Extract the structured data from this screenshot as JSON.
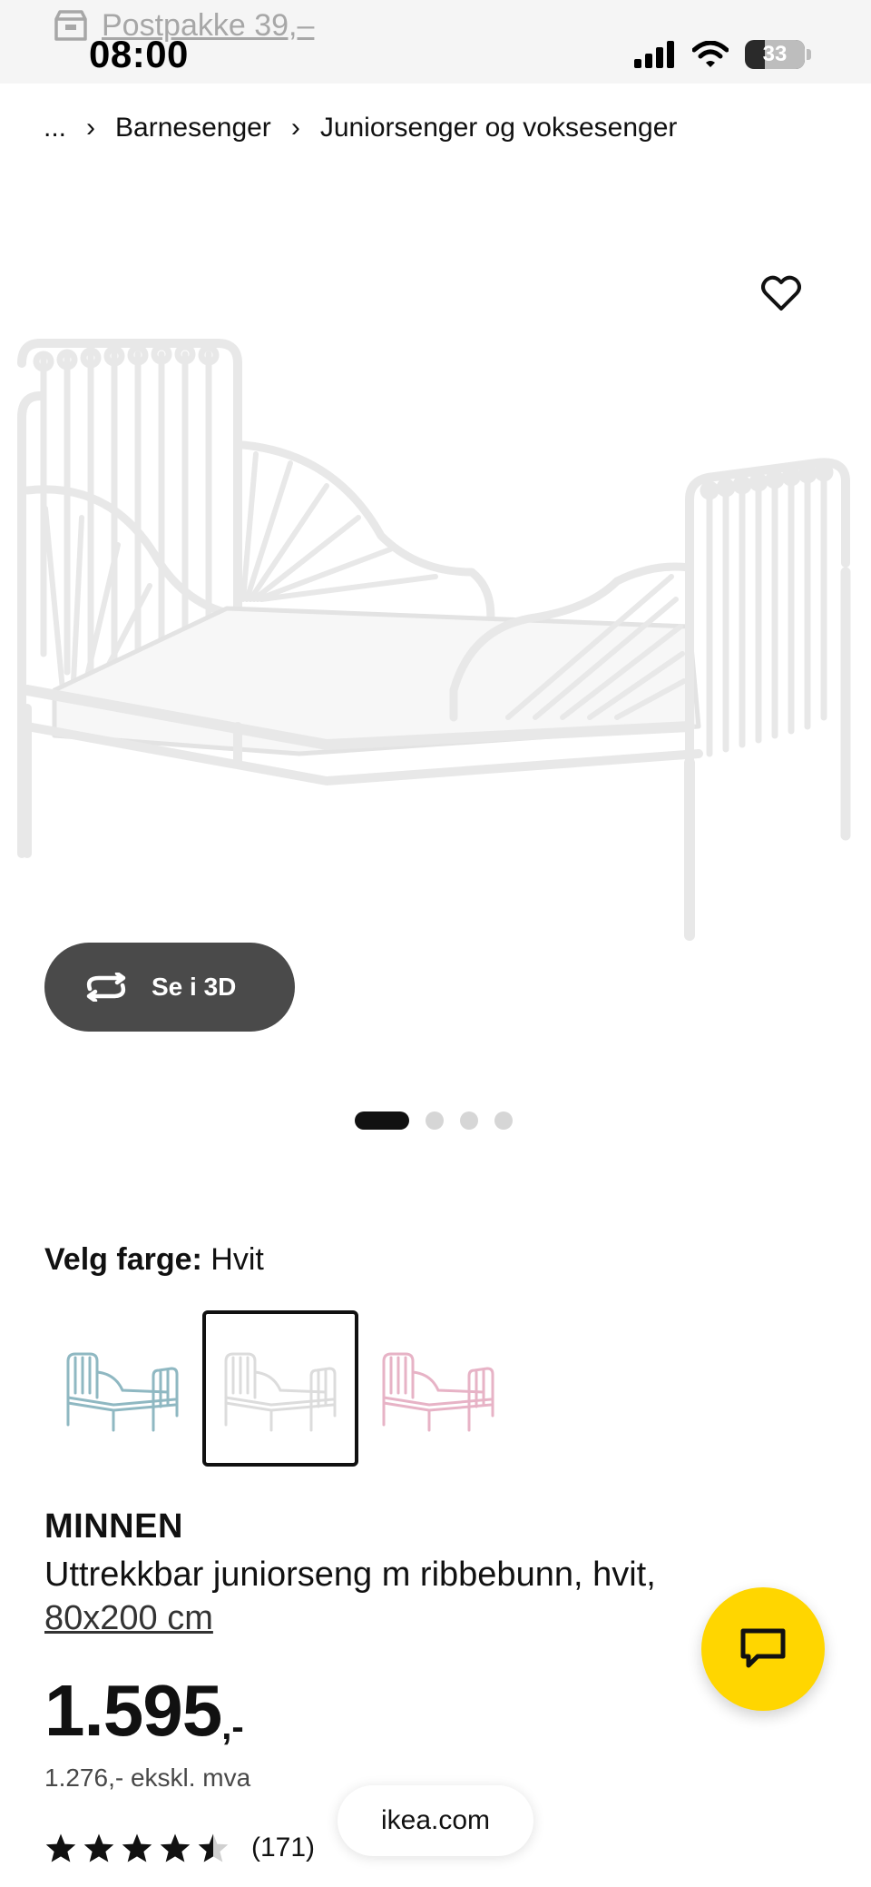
{
  "status_bar": {
    "time": "08:00",
    "notification_text": "Postpakke 39,–",
    "battery_level": "33",
    "icons": [
      "cellular-signal-icon",
      "wifi-icon",
      "battery-icon",
      "package-icon"
    ]
  },
  "breadcrumb": {
    "ellipsis": "...",
    "items": [
      "Barnesenger",
      "Juniorsenger og voksesenger"
    ],
    "separator_icon": "chevron-right-icon"
  },
  "gallery": {
    "view_3d_label": "Se i 3D",
    "view_3d_icon": "rotate-3d-icon",
    "favourite_icon": "heart-icon",
    "image_count": 4,
    "active_index": 0
  },
  "color_picker": {
    "label": "Velg farge:",
    "selected_value": "Hvit",
    "options": [
      {
        "name": "Turkis",
        "color": "#8fb8c2",
        "selected": false
      },
      {
        "name": "Hvit",
        "color": "#e4e4e4",
        "selected": true
      },
      {
        "name": "Rosa",
        "color": "#e7b3c6",
        "selected": false
      }
    ]
  },
  "product": {
    "name": "MINNEN",
    "description": "Uttrekkbar juniorseng m ribbebunn, hvit,",
    "size": "80x200 cm",
    "price": "1.595",
    "price_suffix": ",-",
    "price_ex_vat": "1.276,- ekskl. mva",
    "rating": 4.5,
    "review_count": "(171)"
  },
  "chat": {
    "icon": "chat-bubble-icon",
    "color": "#ffd600"
  },
  "browser": {
    "url": "ikea.com"
  }
}
